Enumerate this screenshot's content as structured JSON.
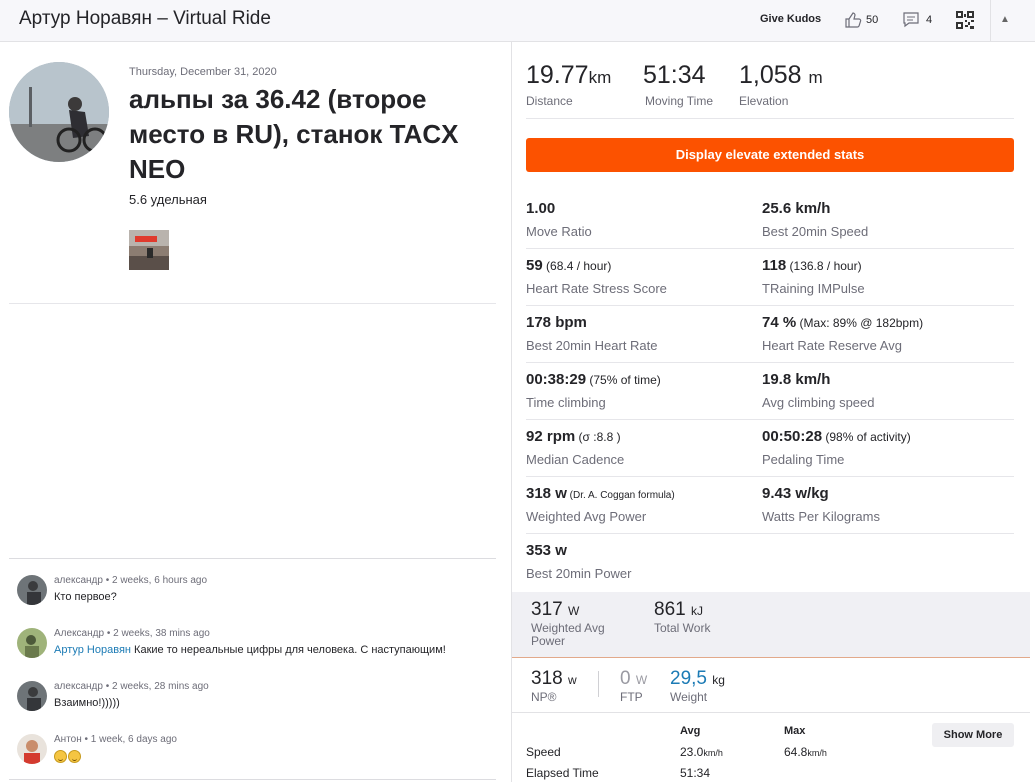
{
  "header": {
    "title": "Артур Норавян – Virtual Ride",
    "give_kudos": "Give Kudos",
    "kudos_count": "50",
    "comment_count": "4"
  },
  "activity": {
    "date": "Thursday, December 31, 2020",
    "title": "альпы за 36.42 (второе место в RU), станок TACX NEO",
    "description": "5.6 удельная"
  },
  "comments": [
    {
      "author": "александр",
      "meta": " • 2 weeks, 6 hours ago",
      "text": "Кто первое?",
      "mention": ""
    },
    {
      "author": "Александр",
      "meta": " • 2 weeks, 38 mins ago",
      "mention": "Артур Норавян",
      "text": " Какие то нереальные цифры для человека. С наступающим!"
    },
    {
      "author": "александр",
      "meta": " • 2 weeks, 28 mins ago",
      "text": "Взаимно!)))))",
      "mention": ""
    },
    {
      "author": "Антон",
      "meta": " • 1 week, 6 days ago",
      "text": "",
      "mention": ""
    }
  ],
  "summary": {
    "distance": {
      "value": "19.77",
      "unit": "km",
      "label": "Distance"
    },
    "moving_time": {
      "value": "51:34",
      "label": "Moving Time"
    },
    "elevation": {
      "value": "1,058",
      "unit": "m",
      "label": "Elevation"
    }
  },
  "elevate_button": "Display elevate extended stats",
  "stats": [
    {
      "value": "1.00",
      "extra": "",
      "label": "Move Ratio"
    },
    {
      "value": "25.6 km/h",
      "extra": "",
      "label": "Best 20min Speed"
    },
    {
      "value": "59",
      "extra": " (68.4 / hour)",
      "label": "Heart Rate Stress Score"
    },
    {
      "value": "118",
      "extra": " (136.8 / hour)",
      "label": "TRaining IMPulse"
    },
    {
      "value": "178 bpm",
      "extra": "",
      "label": "Best 20min Heart Rate"
    },
    {
      "value": "74 %",
      "extra": " (Max: 89% @ 182bpm)",
      "label": "Heart Rate Reserve Avg"
    },
    {
      "value": "00:38:29",
      "extra": " (75% of time)",
      "label": "Time climbing"
    },
    {
      "value": "19.8 km/h",
      "extra": "",
      "label": "Avg climbing speed"
    },
    {
      "value": "92 rpm",
      "extra": " (σ :8.8 )",
      "label": "Median Cadence"
    },
    {
      "value": "00:50:28",
      "extra": " (98% of activity)",
      "label": "Pedaling Time"
    },
    {
      "value": "318 w",
      "extra": " (Dr. A. Coggan formula)",
      "label": "Weighted Avg Power"
    },
    {
      "value": "9.43 w/kg",
      "extra": "",
      "label": "Watts Per Kilograms"
    },
    {
      "value": "353 w",
      "extra": "",
      "label": "Best 20min Power"
    }
  ],
  "power": {
    "weighted_avg": {
      "value": "317",
      "unit": "W",
      "label": "Weighted Avg Power"
    },
    "total_work": {
      "value": "861",
      "unit": "kJ",
      "label": "Total Work"
    }
  },
  "np": {
    "np": {
      "value": "318",
      "unit": "w",
      "label": "NP®"
    },
    "ftp": {
      "value": "0",
      "unit": "W",
      "label": "FTP"
    },
    "weight": {
      "value": "29,5",
      "unit": "kg",
      "label": "Weight"
    }
  },
  "table": {
    "col_avg": "Avg",
    "col_max": "Max",
    "show_more": "Show More",
    "rows": [
      {
        "label": "Speed",
        "avg": "23.0",
        "avg_unit": "km/h",
        "max": "64.8",
        "max_unit": "km/h"
      },
      {
        "label": "Elapsed Time",
        "avg": "51:34",
        "avg_unit": "",
        "max": "",
        "max_unit": ""
      }
    ]
  },
  "colors": {
    "accent": "#fc5200",
    "link": "#1c7bb5"
  }
}
